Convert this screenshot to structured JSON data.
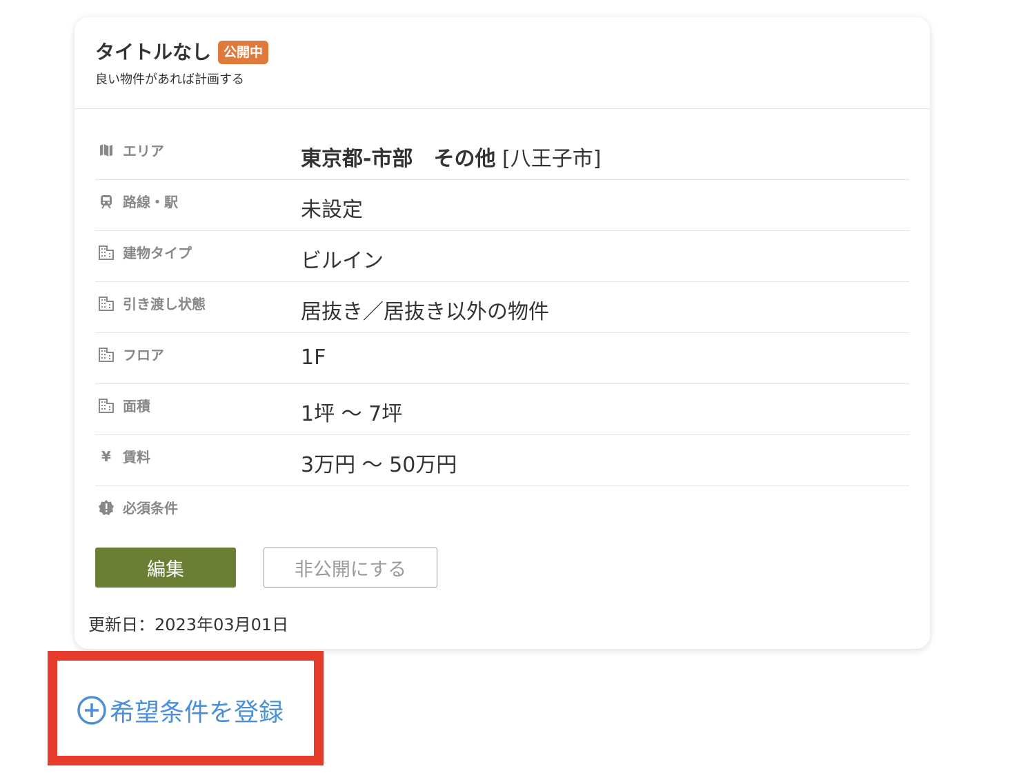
{
  "card": {
    "title": "タイトルなし",
    "status_badge": "公開中",
    "subtitle": "良い物件があれば計画する",
    "rows": [
      {
        "icon": "map-icon",
        "label": "エリア",
        "value_bold": "東京都-市部　その他",
        "value_rest": " [八王子市]"
      },
      {
        "icon": "train-icon",
        "label": "路線・駅",
        "value": "未設定"
      },
      {
        "icon": "building-icon",
        "label": "建物タイプ",
        "value": "ビルイン"
      },
      {
        "icon": "building-icon",
        "label": "引き渡し状態",
        "value": "居抜き／居抜き以外の物件"
      },
      {
        "icon": "building-icon",
        "label": "フロア",
        "value": "1F"
      },
      {
        "icon": "building-icon",
        "label": "面積",
        "value": "1坪 ～ 7坪"
      },
      {
        "icon": "yen-icon",
        "label": "賃料",
        "value": "3万円 ～ 50万円"
      },
      {
        "icon": "alert-badge-icon",
        "label": "必須条件",
        "value": ""
      }
    ],
    "edit_label": "編集",
    "private_label": "非公開にする",
    "updated_text": "更新日：2023年03月01日"
  },
  "register": {
    "label": "希望条件を登録",
    "icon": "plus-circle-icon"
  },
  "colors": {
    "badge": "#e07a3c",
    "edit_button": "#6a7f33",
    "link": "#4a8fd8",
    "highlight": "#e53b2a"
  }
}
